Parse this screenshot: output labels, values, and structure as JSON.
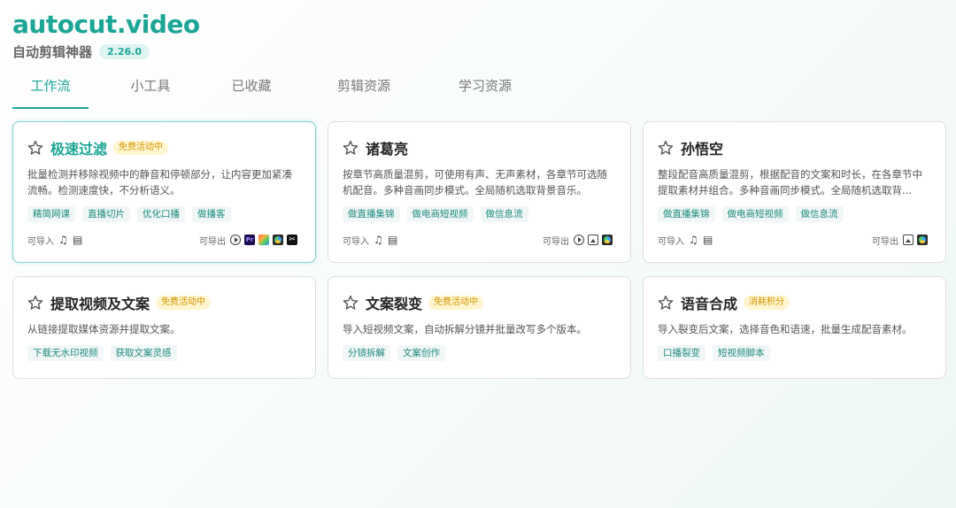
{
  "app": {
    "brand": "autocut.video",
    "subtitle": "自动剪辑神器",
    "version": "2.26.0"
  },
  "tabs": [
    {
      "label": "工作流",
      "active": true
    },
    {
      "label": "小工具",
      "active": false
    },
    {
      "label": "已收藏",
      "active": false
    },
    {
      "label": "剪辑资源",
      "active": false
    },
    {
      "label": "学习资源",
      "active": false
    }
  ],
  "labels": {
    "import": "可导入",
    "export": "可导出"
  },
  "cards": [
    {
      "title": "极速过滤",
      "badge": "免费活动中",
      "desc": "批量检测并移除视频中的静音和停顿部分，让内容更加紧凑流畅。检测速度快，不分析语义。",
      "tags": [
        "精简网课",
        "直播切片",
        "优化口播",
        "做播客"
      ],
      "imports": [
        "music-icon",
        "film-icon"
      ],
      "exports": [
        "play-icon",
        "premiere-pro-icon",
        "final-cut-pro-icon",
        "davinci-resolve-icon",
        "capcut-icon"
      ]
    },
    {
      "title": "诸葛亮",
      "badge": "",
      "desc": "按章节高质量混剪，可使用有声、无声素材，各章节可选随机配音。多种音画同步模式。全局随机选取背景音乐。",
      "tags": [
        "做直播集锦",
        "做电商短视频",
        "做信息流"
      ],
      "imports": [
        "music-icon",
        "film-icon"
      ],
      "exports": [
        "play-icon",
        "image-icon",
        "davinci-resolve-icon"
      ]
    },
    {
      "title": "孙悟空",
      "badge": "",
      "desc": "整段配音高质量混剪，根据配音的文案和时长，在各章节中提取素材并组合。多种音画同步模式。全局随机选取背...",
      "tags": [
        "做直播集锦",
        "做电商短视频",
        "做信息流"
      ],
      "imports": [
        "music-icon",
        "film-icon"
      ],
      "exports": [
        "image-icon",
        "davinci-resolve-icon"
      ]
    },
    {
      "title": "提取视频及文案",
      "badge": "免费活动中",
      "desc": "从链接提取媒体资源并提取文案。",
      "tags": [
        "下载无水印视频",
        "获取文案灵感"
      ]
    },
    {
      "title": "文案裂变",
      "badge": "免费活动中",
      "desc": "导入短视频文案，自动拆解分镜并批量改写多个版本。",
      "tags": [
        "分镜拆解",
        "文案创作"
      ]
    },
    {
      "title": "语音合成",
      "badge": "消耗积分",
      "desc": "导入裂变后文案，选择音色和语速，批量生成配音素材。",
      "tags": [
        "口播裂变",
        "短视频脚本"
      ]
    }
  ]
}
